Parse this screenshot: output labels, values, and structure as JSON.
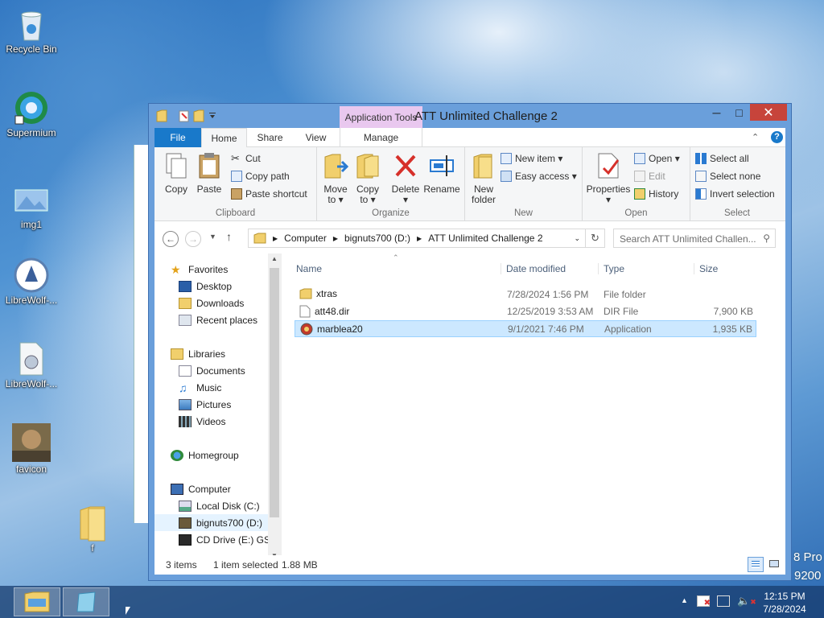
{
  "desktop": {
    "icons": [
      {
        "label": "Recycle Bin",
        "icon": "recycle-bin-icon"
      },
      {
        "label": "Supermium",
        "icon": "supermium-icon"
      },
      {
        "label": "img1",
        "icon": "image-file-icon"
      },
      {
        "label": "LibreWolf-...",
        "icon": "librewolf-icon"
      },
      {
        "label": "LibreWolf-...",
        "icon": "librewolf-settings-icon"
      },
      {
        "label": "favicon",
        "icon": "favicon-image-icon"
      },
      {
        "label": "f",
        "icon": "folder-icon"
      }
    ],
    "watermark": {
      "line1": "8 Pro",
      "line2": "9200"
    }
  },
  "window": {
    "title": "ATT Unlimited Challenge 2",
    "context_tab": "Application Tools",
    "tabs": [
      "File",
      "Home",
      "Share",
      "View",
      "Manage"
    ],
    "ribbon": {
      "clipboard": {
        "label": "Clipboard",
        "copy": "Copy",
        "paste": "Paste",
        "cut": "Cut",
        "copy_path": "Copy path",
        "paste_shortcut": "Paste shortcut"
      },
      "organize": {
        "label": "Organize",
        "move_to": "Move",
        "move_to2": "to ▾",
        "copy_to": "Copy",
        "copy_to2": "to ▾",
        "delete": "Delete",
        "delete2": "▾",
        "rename": "Rename"
      },
      "new": {
        "label": "New",
        "new_folder": "New",
        "new_folder2": "folder",
        "new_item": "New item ▾",
        "easy_access": "Easy access ▾"
      },
      "open": {
        "label": "Open",
        "properties": "Properties",
        "properties2": "▾",
        "open": "Open ▾",
        "edit": "Edit",
        "history": "History"
      },
      "select": {
        "label": "Select",
        "select_all": "Select all",
        "select_none": "Select none",
        "invert": "Invert selection"
      }
    },
    "address": {
      "crumbs": [
        "Computer",
        "bignuts700 (D:)",
        "ATT Unlimited Challenge 2"
      ],
      "search_placeholder": "Search ATT Unlimited Challen..."
    },
    "nav": {
      "favorites": "Favorites",
      "desktop": "Desktop",
      "downloads": "Downloads",
      "recent": "Recent places",
      "libraries": "Libraries",
      "documents": "Documents",
      "music": "Music",
      "pictures": "Pictures",
      "videos": "Videos",
      "homegroup": "Homegroup",
      "computer": "Computer",
      "local_disk": "Local Disk (C:)",
      "bignuts": "bignuts700 (D:)",
      "cd_drive": "CD Drive (E:) GSP"
    },
    "columns": {
      "name": "Name",
      "date": "Date modified",
      "type": "Type",
      "size": "Size"
    },
    "files": [
      {
        "name": "xtras",
        "date": "7/28/2024 1:56 PM",
        "type": "File folder",
        "size": "",
        "icon": "folder-icon"
      },
      {
        "name": "att48.dir",
        "date": "12/25/2019 3:53 AM",
        "type": "DIR File",
        "size": "7,900 KB",
        "icon": "file-icon"
      },
      {
        "name": "marblea20",
        "date": "9/1/2021 7:46 PM",
        "type": "Application",
        "size": "1,935 KB",
        "icon": "application-icon"
      }
    ],
    "status": {
      "count": "3 items",
      "selected": "1 item selected",
      "size": "1.88 MB"
    }
  },
  "taskbar": {
    "time": "12:15 PM",
    "date": "7/28/2024",
    "tray_arrow": "▲"
  }
}
